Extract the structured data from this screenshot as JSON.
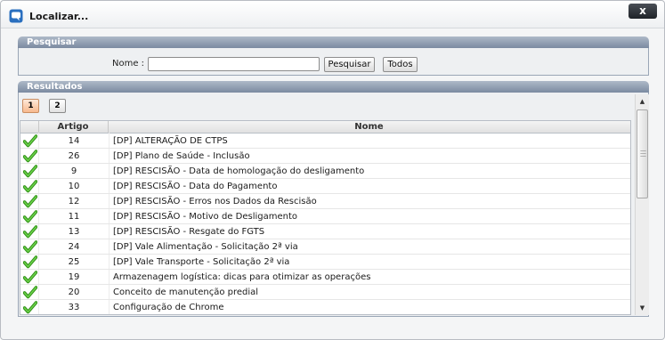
{
  "window": {
    "title": "Localizar...",
    "close_label": "x"
  },
  "search_panel": {
    "header": "Pesquisar",
    "name_label": "Nome :",
    "name_value": "",
    "search_button": "Pesquisar",
    "all_button": "Todos"
  },
  "results_panel": {
    "header": "Resultados",
    "pages": [
      "1",
      "2"
    ],
    "active_page": "1",
    "columns": [
      "Artigo",
      "Nome"
    ],
    "rows": [
      {
        "artigo": "14",
        "nome": "[DP] ALTERAÇÃO DE CTPS"
      },
      {
        "artigo": "26",
        "nome": "[DP] Plano de Saúde - Inclusão"
      },
      {
        "artigo": "9",
        "nome": "[DP] RESCISÃO - Data de homologação do desligamento"
      },
      {
        "artigo": "10",
        "nome": "[DP] RESCISÃO - Data do Pagamento"
      },
      {
        "artigo": "12",
        "nome": "[DP] RESCISÃO - Erros nos Dados da Rescisão"
      },
      {
        "artigo": "11",
        "nome": "[DP] RESCISÃO - Motivo de Desligamento"
      },
      {
        "artigo": "13",
        "nome": "[DP] RESCISÃO - Resgate do FGTS"
      },
      {
        "artigo": "24",
        "nome": "[DP] Vale Alimentação - Solicitação 2ª via"
      },
      {
        "artigo": "25",
        "nome": "[DP] Vale Transporte - Solicitação 2ª via"
      },
      {
        "artigo": "19",
        "nome": "Armazenagem logística: dicas para otimizar as operações"
      },
      {
        "artigo": "20",
        "nome": "Conceito de manutenção predial"
      },
      {
        "artigo": "33",
        "nome": "Configuração de Chrome"
      }
    ],
    "row_icon": "check-icon"
  },
  "colors": {
    "panel_header": "#8392a8",
    "check_green": "#3aa81f",
    "active_page": "#f7b98e"
  }
}
